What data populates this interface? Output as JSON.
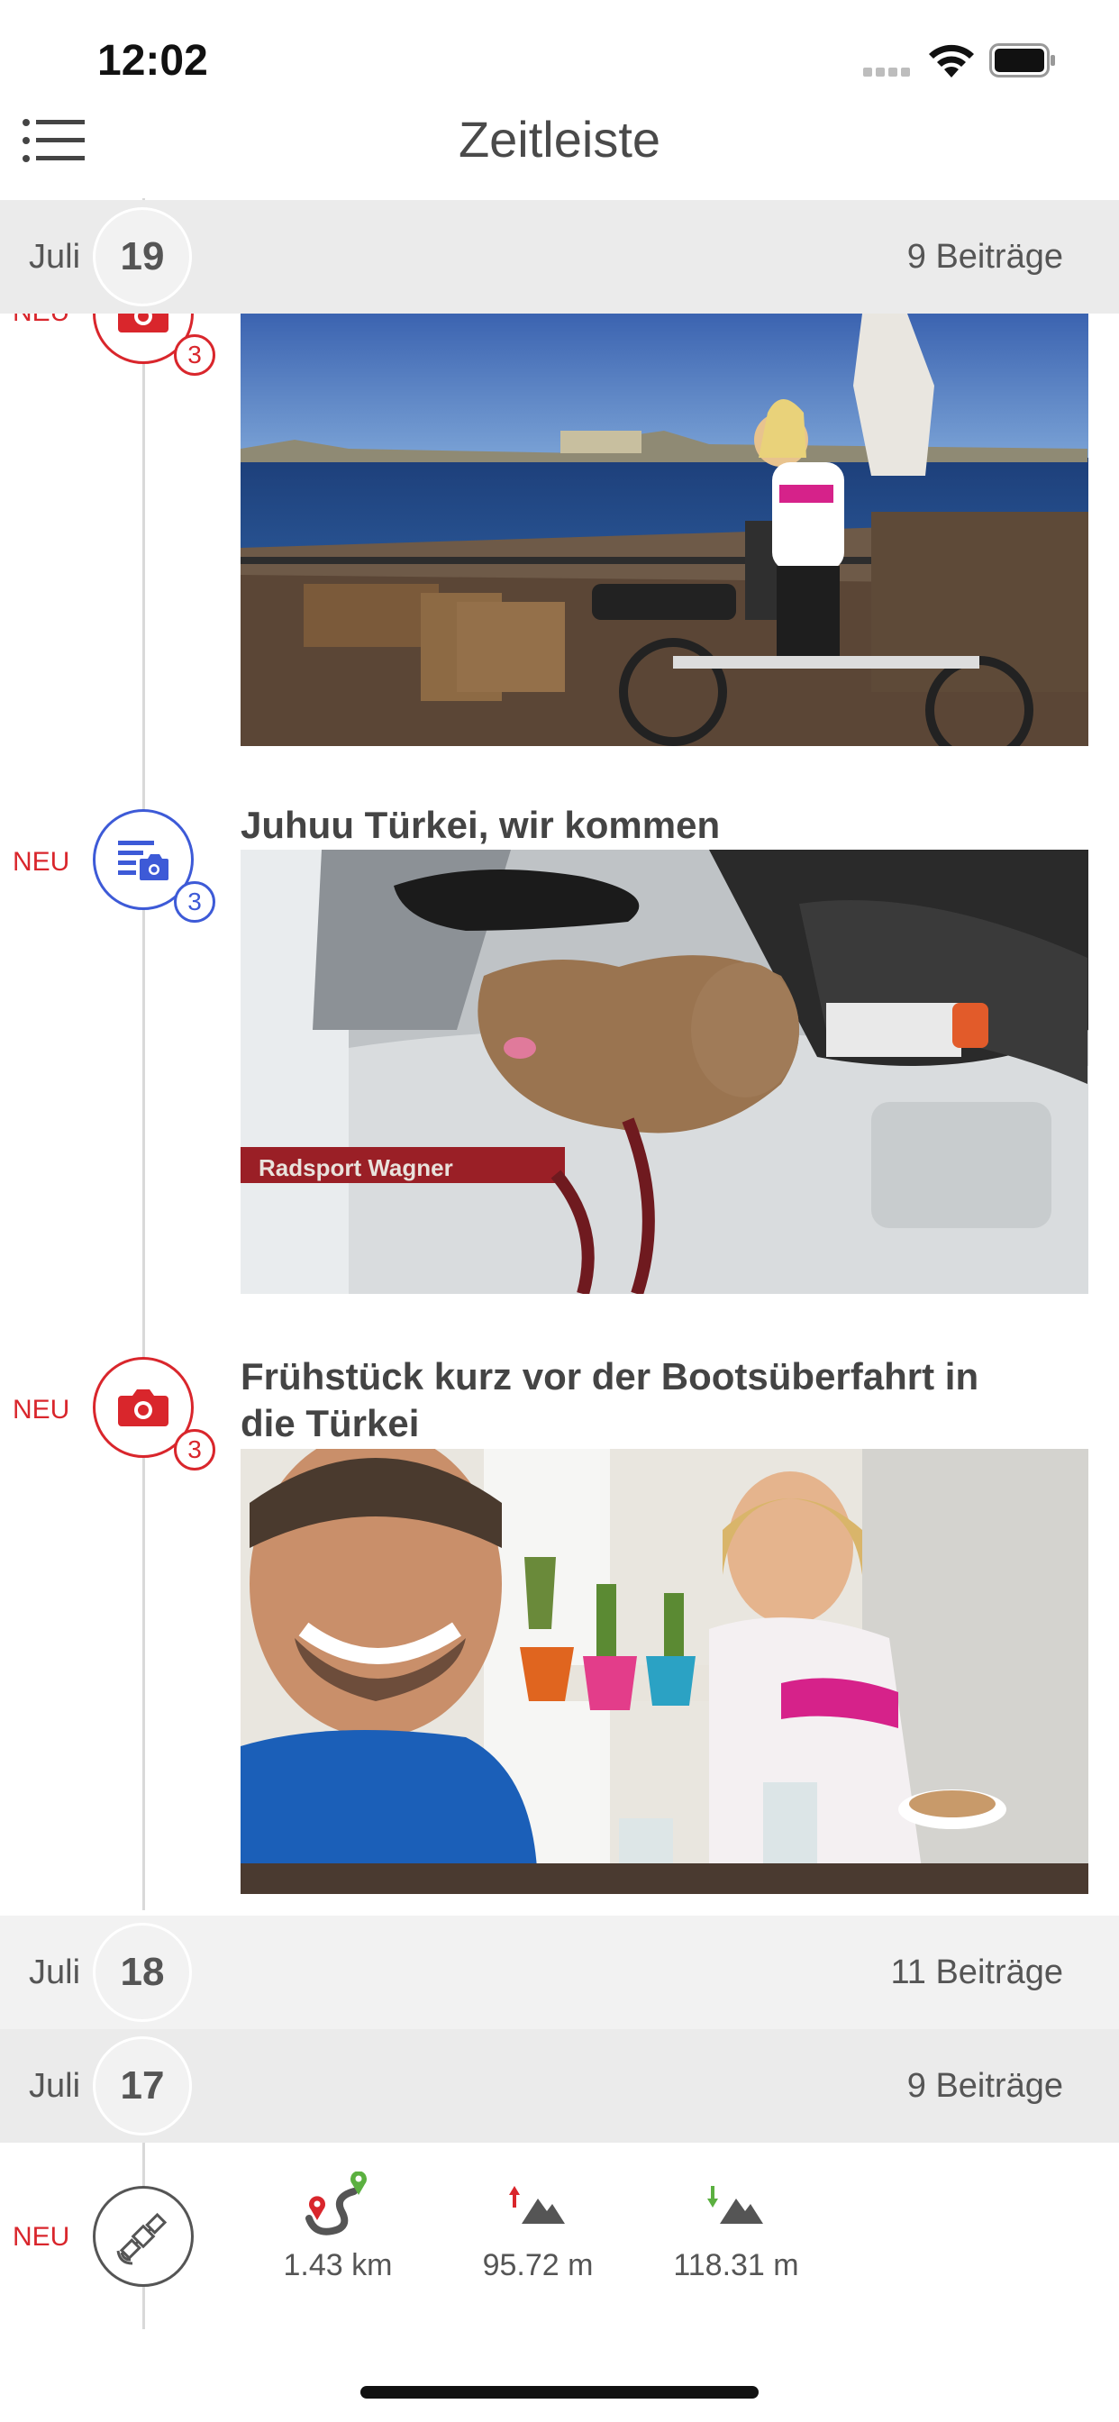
{
  "status_bar": {
    "time": "12:02"
  },
  "nav": {
    "title": "Zeitleiste",
    "menu_icon": "list-menu-icon"
  },
  "days": [
    {
      "month": "Juli",
      "day": "19",
      "count": "9 Beiträge"
    },
    {
      "month": "Juli",
      "day": "18",
      "count": "11 Beiträge"
    },
    {
      "month": "Juli",
      "day": "17",
      "count": "9 Beiträge"
    }
  ],
  "entries": [
    {
      "new_label": "NEU",
      "icon": "camera-icon",
      "badge": "3",
      "title": ""
    },
    {
      "new_label": "NEU",
      "icon": "text-photo-icon",
      "badge": "3",
      "title": "Juhuu Türkei, wir kommen"
    },
    {
      "new_label": "NEU",
      "icon": "camera-icon",
      "badge": "3",
      "title": "Frühstück kurz vor der Bootsüberfahrt in die Türkei"
    },
    {
      "new_label": "NEU",
      "icon": "satellite-icon"
    }
  ],
  "track_stats": [
    {
      "icon": "route-icon",
      "value": "1.43 km"
    },
    {
      "icon": "ascent-icon",
      "value": "95.72 m"
    },
    {
      "icon": "descent-icon",
      "value": "118.31 m"
    }
  ],
  "photo_captions": {
    "photo2_text": "Radsport Wagner"
  },
  "colors": {
    "accent_red": "#d9262c",
    "accent_blue": "#3d5ad7"
  }
}
